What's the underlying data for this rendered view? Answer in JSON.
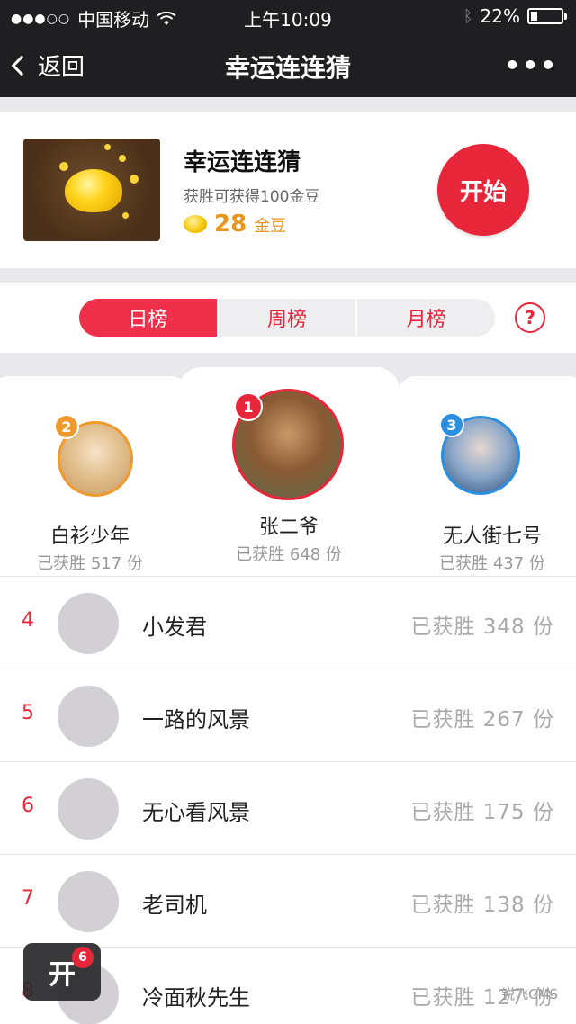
{
  "status_bar": {
    "carrier": "中国移动",
    "time": "上午10:09",
    "battery": "22%",
    "battery_level": 0.22,
    "signal_icon": "signal-dots-icon",
    "wifi_icon": "wifi-icon",
    "bluetooth_icon": "bluetooth-icon"
  },
  "navbar": {
    "back_label": "返回",
    "title": "幸运连连猜",
    "more_label": "•••"
  },
  "game": {
    "name": "幸运连连猜",
    "description": "获胜可获得100金豆",
    "coins": "28",
    "coin_unit": "金豆",
    "start_label": "开始"
  },
  "tabs": [
    {
      "label": "日榜",
      "active": true
    },
    {
      "label": "周榜",
      "active": false
    },
    {
      "label": "月榜",
      "active": false
    }
  ],
  "help_label": "?",
  "podium": [
    {
      "rank": "2",
      "name": "白衫少年",
      "wins": "已获胜 517 份",
      "badge_color": "#f09a2e"
    },
    {
      "rank": "1",
      "name": "张二爷",
      "wins": "已获胜 648 份",
      "badge_color": "#e8263a"
    },
    {
      "rank": "3",
      "name": "无人街七号",
      "wins": "已获胜 437 份",
      "badge_color": "#2a8fe0"
    }
  ],
  "ranking": [
    {
      "rank": "4",
      "name": "小发君",
      "wins": "已获胜 348 份"
    },
    {
      "rank": "5",
      "name": "一路的风景",
      "wins": "已获胜 267 份"
    },
    {
      "rank": "6",
      "name": "无心看风景",
      "wins": "已获胜 175 份"
    },
    {
      "rank": "7",
      "name": "老司机",
      "wins": "已获胜 138 份"
    },
    {
      "rank": "8",
      "name": "冷面秋先生",
      "wins": "已获胜 127 份"
    }
  ],
  "float_button": {
    "label": "开",
    "badge": "6"
  },
  "watermark": "锐飞CMS",
  "colors": {
    "accent": "#e8263a",
    "gold": "#e6961e",
    "nav_bg": "#1f1f21"
  }
}
